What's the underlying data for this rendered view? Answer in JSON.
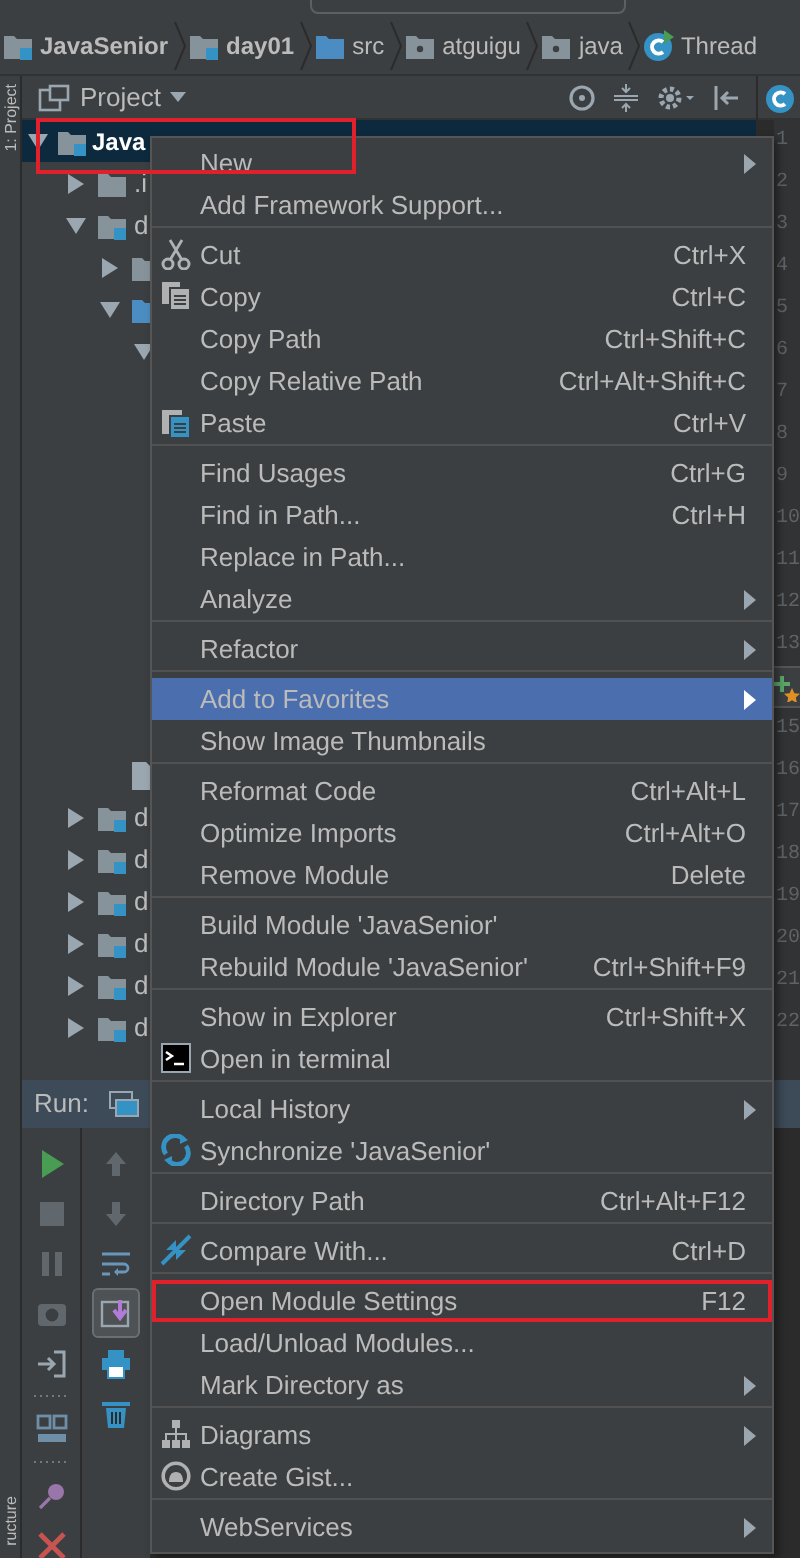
{
  "breadcrumbs": [
    {
      "label": "JavaSenior",
      "kind": "module"
    },
    {
      "label": "day01",
      "kind": "module"
    },
    {
      "label": "src",
      "kind": "folder"
    },
    {
      "label": "atguigu",
      "kind": "package"
    },
    {
      "label": "java",
      "kind": "package"
    },
    {
      "label": "Thread",
      "kind": "class"
    }
  ],
  "side_stripe": {
    "top": "1: Project",
    "bottom": "ructure"
  },
  "project_panel": {
    "title": "Project"
  },
  "tree": [
    {
      "label": "Java",
      "kind": "module",
      "expanded": true,
      "selected": true,
      "outlined": true,
      "children": [
        {
          "label": ".i",
          "kind": "folder",
          "expanded": false,
          "selected": false
        },
        {
          "label": "d",
          "kind": "module",
          "expanded": true,
          "selected": false,
          "children": [
            {
              "kind": "folder",
              "expanded": false,
              "selected": false
            },
            {
              "kind": "source",
              "expanded": true,
              "selected": false,
              "children": [
                {
                  "expanded": true,
                  "selected": false
                }
              ]
            },
            {
              "kind": "file",
              "selected": false
            }
          ]
        },
        {
          "label": "d",
          "kind": "module",
          "expanded": false,
          "selected": false
        },
        {
          "label": "d",
          "kind": "module",
          "expanded": false,
          "selected": false
        },
        {
          "label": "d",
          "kind": "module",
          "expanded": false,
          "selected": false
        },
        {
          "label": "d",
          "kind": "module",
          "expanded": false,
          "selected": false
        },
        {
          "label": "d",
          "kind": "module",
          "expanded": false,
          "selected": false
        },
        {
          "label": "d",
          "kind": "module",
          "expanded": false,
          "selected": false
        }
      ]
    }
  ],
  "gutter": [
    {
      "kind": "number",
      "text": "1"
    },
    {
      "kind": "number",
      "text": "2"
    },
    {
      "kind": "number",
      "text": "3"
    },
    {
      "kind": "number",
      "text": "4"
    },
    {
      "kind": "number",
      "text": "5"
    },
    {
      "kind": "number",
      "text": "6"
    },
    {
      "kind": "number",
      "text": "7"
    },
    {
      "kind": "number",
      "text": "8"
    },
    {
      "kind": "number",
      "text": "9"
    },
    {
      "kind": "number",
      "text": "10"
    },
    {
      "kind": "number",
      "text": "11"
    },
    {
      "kind": "number",
      "text": "12"
    },
    {
      "kind": "number",
      "text": "13"
    },
    {
      "kind": "submenu-peek"
    },
    {
      "kind": "number",
      "text": "15"
    },
    {
      "kind": "number",
      "text": "16"
    },
    {
      "kind": "number",
      "text": "17"
    },
    {
      "kind": "number",
      "text": "18"
    },
    {
      "kind": "number",
      "text": "19"
    },
    {
      "kind": "number",
      "text": "20"
    },
    {
      "kind": "number",
      "text": "21"
    },
    {
      "kind": "number",
      "text": "22"
    }
  ],
  "run_panel": {
    "title": "Run:",
    "toolbar_1": [
      {
        "kind": "run",
        "disabled": false
      },
      {
        "kind": "stop",
        "disabled": true
      },
      {
        "kind": "pause",
        "disabled": true
      },
      {
        "kind": "camera",
        "disabled": true
      },
      {
        "kind": "exit",
        "disabled": false
      },
      {
        "kind": "dots"
      },
      {
        "kind": "layout",
        "disabled": false
      },
      {
        "kind": "dots"
      },
      {
        "kind": "pin",
        "disabled": false
      },
      {
        "kind": "close",
        "disabled": false
      }
    ],
    "toolbar_2": [
      {
        "kind": "up",
        "disabled": true,
        "selected": false
      },
      {
        "kind": "down",
        "disabled": true,
        "selected": false
      },
      {
        "kind": "wrap",
        "disabled": false,
        "selected": false
      },
      {
        "kind": "scroll-end",
        "disabled": false,
        "selected": true
      },
      {
        "kind": "print",
        "disabled": false,
        "selected": false
      },
      {
        "kind": "trash",
        "disabled": false,
        "selected": false
      }
    ]
  },
  "context_menu": {
    "groups": [
      [
        {
          "label": "New",
          "kind": "plain",
          "submenu": true,
          "selected": false
        },
        {
          "label": "Add Framework Support...",
          "kind": "plain",
          "submenu": false,
          "selected": false
        }
      ],
      [
        {
          "label": "Cut",
          "kind": "cut",
          "shortcut": "Ctrl+X",
          "submenu": false,
          "selected": false
        },
        {
          "label": "Copy",
          "kind": "copy",
          "shortcut": "Ctrl+C",
          "submenu": false,
          "selected": false
        },
        {
          "label": "Copy Path",
          "kind": "plain",
          "shortcut": "Ctrl+Shift+C",
          "submenu": false,
          "selected": false
        },
        {
          "label": "Copy Relative Path",
          "kind": "plain",
          "shortcut": "Ctrl+Alt+Shift+C",
          "submenu": false,
          "selected": false
        },
        {
          "label": "Paste",
          "kind": "paste",
          "shortcut": "Ctrl+V",
          "submenu": false,
          "selected": false
        }
      ],
      [
        {
          "label": "Find Usages",
          "kind": "plain",
          "shortcut": "Ctrl+G",
          "submenu": false,
          "selected": false
        },
        {
          "label": "Find in Path...",
          "kind": "plain",
          "shortcut": "Ctrl+H",
          "submenu": false,
          "selected": false
        },
        {
          "label": "Replace in Path...",
          "kind": "plain",
          "submenu": false,
          "selected": false
        },
        {
          "label": "Analyze",
          "kind": "plain",
          "submenu": true,
          "selected": false
        }
      ],
      [
        {
          "label": "Refactor",
          "kind": "plain",
          "submenu": true,
          "selected": false
        }
      ],
      [
        {
          "label": "Add to Favorites",
          "kind": "plain",
          "submenu": true,
          "selected": true
        },
        {
          "label": "Show Image Thumbnails",
          "kind": "plain",
          "submenu": false,
          "selected": false
        }
      ],
      [
        {
          "label": "Reformat Code",
          "kind": "plain",
          "shortcut": "Ctrl+Alt+L",
          "submenu": false,
          "selected": false
        },
        {
          "label": "Optimize Imports",
          "kind": "plain",
          "shortcut": "Ctrl+Alt+O",
          "submenu": false,
          "selected": false
        },
        {
          "label": "Remove Module",
          "kind": "plain",
          "shortcut": "Delete",
          "submenu": false,
          "selected": false
        }
      ],
      [
        {
          "label": "Build Module 'JavaSenior'",
          "kind": "plain",
          "submenu": false,
          "selected": false
        },
        {
          "label": "Rebuild Module 'JavaSenior'",
          "kind": "plain",
          "shortcut": "Ctrl+Shift+F9",
          "submenu": false,
          "selected": false
        }
      ],
      [
        {
          "label": "Show in Explorer",
          "kind": "plain",
          "shortcut": "Ctrl+Shift+X",
          "submenu": false,
          "selected": false
        },
        {
          "label": "Open in terminal",
          "kind": "terminal",
          "submenu": false,
          "selected": false
        }
      ],
      [
        {
          "label": "Local History",
          "kind": "plain",
          "submenu": true,
          "selected": false
        },
        {
          "label": "Synchronize 'JavaSenior'",
          "kind": "sync",
          "submenu": false,
          "selected": false
        }
      ],
      [
        {
          "label": "Directory Path",
          "kind": "plain",
          "shortcut": "Ctrl+Alt+F12",
          "submenu": false,
          "selected": false
        }
      ],
      [
        {
          "label": "Compare With...",
          "kind": "compare",
          "shortcut": "Ctrl+D",
          "submenu": false,
          "selected": false
        }
      ],
      [
        {
          "label": "Open Module Settings",
          "kind": "plain",
          "shortcut": "F12",
          "submenu": false,
          "selected": false,
          "outlined": true
        },
        {
          "label": "Load/Unload Modules...",
          "kind": "plain",
          "submenu": false,
          "selected": false
        },
        {
          "label": "Mark Directory as",
          "kind": "plain",
          "submenu": true,
          "selected": false
        }
      ],
      [
        {
          "label": "Diagrams",
          "kind": "diagram",
          "submenu": true,
          "selected": false
        },
        {
          "label": "Create Gist...",
          "kind": "gist",
          "submenu": false,
          "selected": false
        }
      ],
      [
        {
          "label": "WebServices",
          "kind": "plain",
          "submenu": true,
          "selected": false
        }
      ]
    ]
  }
}
